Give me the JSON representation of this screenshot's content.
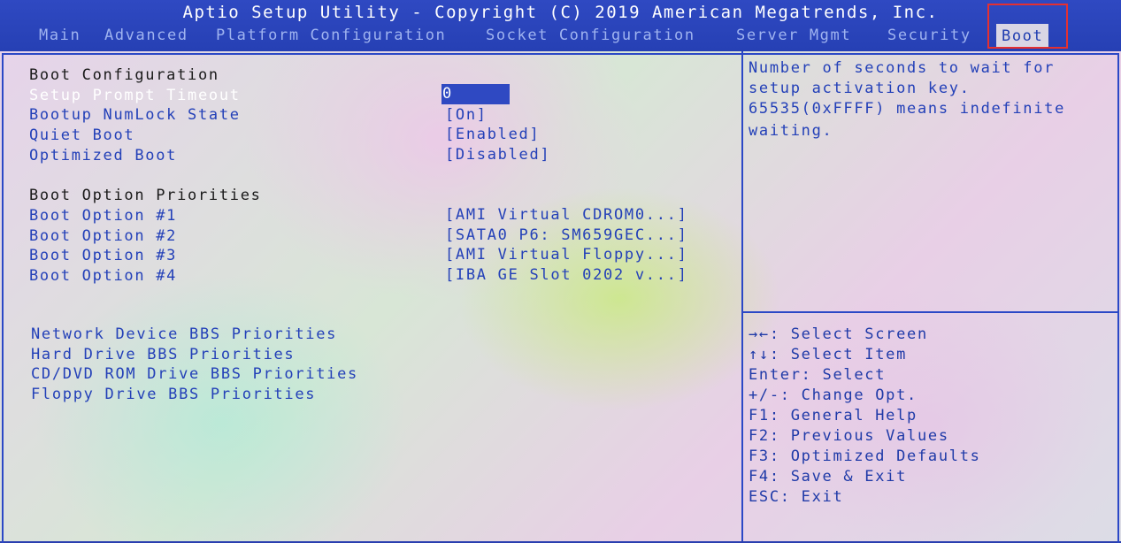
{
  "title": "Aptio Setup Utility - Copyright (C) 2019 American Megatrends, Inc.",
  "tabs": [
    {
      "label": "Main"
    },
    {
      "label": "Advanced"
    },
    {
      "label": "Platform Configuration"
    },
    {
      "label": "Socket Configuration"
    },
    {
      "label": "Server Mgmt"
    },
    {
      "label": "Security"
    },
    {
      "label": "Boot"
    }
  ],
  "active_tab": "Boot",
  "colors": {
    "header_bg": "#2640b4",
    "item_blue": "#2340b8",
    "highlight_red": "#e53030",
    "selection_bg": "#2f49c2"
  },
  "boot_config": {
    "heading": "Boot Configuration",
    "settings": [
      {
        "label": "Setup Prompt Timeout",
        "value": "0"
      },
      {
        "label": "Bootup NumLock State",
        "value": "[On]"
      },
      {
        "label": "Quiet Boot",
        "value": "[Enabled]"
      },
      {
        "label": "Optimized Boot",
        "value": "[Disabled]"
      }
    ]
  },
  "boot_priorities": {
    "heading": "Boot Option Priorities",
    "options": [
      {
        "label": "Boot Option #1",
        "value": "[AMI Virtual CDROM0...]"
      },
      {
        "label": "Boot Option #2",
        "value": "[SATA0 P6: SM659GEC...]"
      },
      {
        "label": "Boot Option #3",
        "value": "[AMI Virtual Floppy...]"
      },
      {
        "label": "Boot Option #4",
        "value": "[IBA GE Slot 0202 v...]"
      }
    ]
  },
  "bbs_links": [
    {
      "label": "Network Device BBS Priorities"
    },
    {
      "label": "Hard Drive BBS Priorities"
    },
    {
      "label": "CD/DVD ROM Drive BBS Priorities"
    },
    {
      "label": "Floppy Drive BBS Priorities"
    }
  ],
  "help": {
    "lines": [
      "Number of seconds to wait for",
      "setup activation key.",
      "65535(0xFFFF) means indefinite",
      "waiting."
    ]
  },
  "keys": [
    {
      "text": "→←: Select Screen"
    },
    {
      "text": "↑↓: Select Item"
    },
    {
      "text": "Enter: Select"
    },
    {
      "text": "+/-: Change Opt."
    },
    {
      "text": "F1: General Help"
    },
    {
      "text": "F2: Previous Values"
    },
    {
      "text": "F3: Optimized Defaults"
    },
    {
      "text": "F4: Save & Exit"
    },
    {
      "text": "ESC: Exit"
    }
  ]
}
